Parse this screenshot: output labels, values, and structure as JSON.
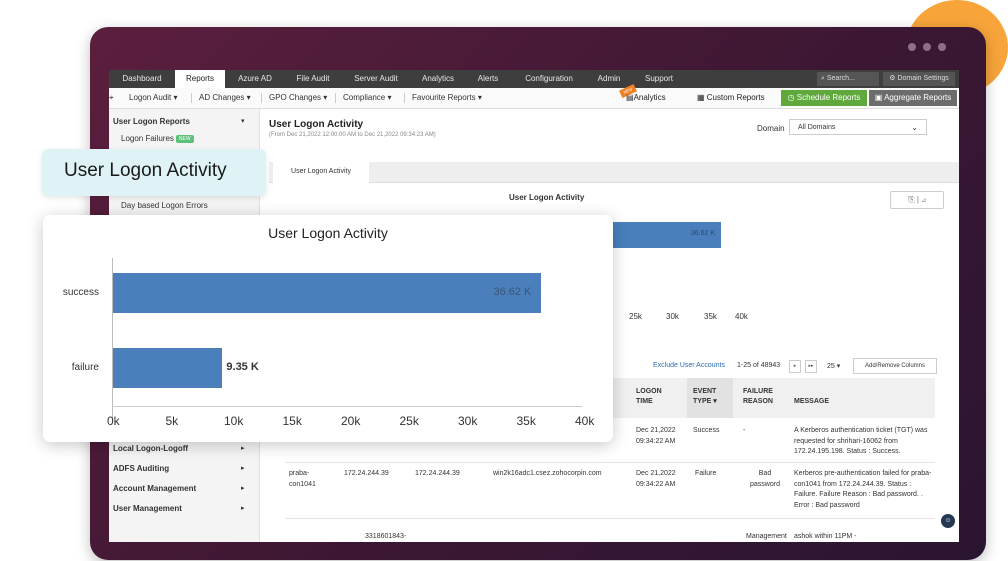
{
  "topnav": {
    "tabs": [
      "Dashboard",
      "Reports",
      "Azure AD",
      "File Audit",
      "Server Audit",
      "Analytics",
      "Alerts",
      "Configuration",
      "Admin",
      "Support"
    ],
    "search": "Search...",
    "domain_settings": "Domain Settings"
  },
  "subnav": {
    "items": [
      "Logon Audit",
      "AD Changes",
      "GPO Changes",
      "Compliance",
      "Favourite Reports"
    ],
    "new_badge": "NEW",
    "analytics": "Analytics",
    "custom_reports": "Custom Reports",
    "schedule_reports": "Schedule Reports",
    "aggregate_reports": "Aggregate Reports"
  },
  "sidebar": {
    "heading": "User Logon Reports",
    "item1": "Logon Failures",
    "badge": "NEW",
    "item2": "Day based Logon Errors",
    "sections": [
      "Local Logon-Logoff",
      "ADFS Auditing",
      "Account Management",
      "User Management"
    ]
  },
  "main": {
    "title": "User Logon Activity",
    "subtitle": "(From Dec 21,2022 12:00:00 AM to Dec 21,2022 09:34:23 AM)",
    "domain_label": "Domain",
    "domain_value": "All Domains",
    "tab": "User Logon Activity"
  },
  "chart_data": {
    "type": "bar",
    "orientation": "horizontal",
    "title": "User Logon Activity",
    "categories": [
      "success",
      "failure"
    ],
    "values": [
      36.62,
      9.35
    ],
    "value_labels": [
      "36.62 K",
      "9.35 K"
    ],
    "xticks": [
      "0k",
      "5k",
      "10k",
      "15k",
      "20k",
      "25k",
      "30k",
      "35k",
      "40k"
    ],
    "xlim": [
      0,
      40
    ]
  },
  "background_chart": {
    "title": "User Logon Activity",
    "bar_label": "36.62 K",
    "ticks": [
      "25k",
      "30k",
      "35k",
      "40k"
    ]
  },
  "table": {
    "exclude": "Exclude User Accounts",
    "count": "1-25 of 48943",
    "per_page": "25",
    "add_remove": "Add/Remove Columns",
    "headers": {
      "logon_time": "LOGON TIME",
      "event_type": "EVENT TYPE",
      "failure_reason": "FAILURE REASON",
      "message": "MESSAGE"
    },
    "row1": {
      "col_frag1": "16062",
      "col_frag2": "om",
      "logon_time": "Dec 21,2022 09:34:22 AM",
      "event_type": "Success",
      "failure_reason": "-",
      "message": "A Kerberos authentication ticket (TGT) was requested for shrihari-16062 from 172.24.195.198. Status : Success."
    },
    "row2": {
      "user": "praba-con1041",
      "ip1": "172.24.244.39",
      "ip2": "172.24.244.39",
      "host": "win2k16adc1.csez.zohocorpin.com",
      "logon_time": "Dec 21,2022 09:34:22 AM",
      "event_type": "Failure",
      "failure_reason": "Bad password",
      "message": "Kerberos pre-authentication failed for praba-con1041 from 172.24.244.39. Status : Failure. Failure Reason : Bad password. . Error : Bad password"
    },
    "row3": {
      "id": "3318601843-",
      "failure_reason": "Management",
      "message": "ashok within 11PM -"
    }
  },
  "overlay": {
    "badge_title": "User Logon Activity"
  }
}
